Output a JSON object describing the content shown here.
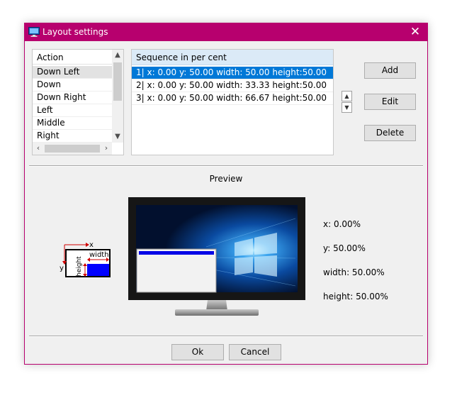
{
  "window": {
    "title": "Layout settings"
  },
  "action_list": {
    "header": "Action",
    "items": [
      "Down Left",
      "Down",
      "Down Right",
      "Left",
      "Middle",
      "Right"
    ],
    "selected": 0
  },
  "sequence_list": {
    "header": "Sequence in per cent",
    "rows": [
      "1|  x:  0.00   y: 50.00   width:  50.00   height:50.00",
      "2|  x:  0.00   y: 50.00   width:  33.33   height:50.00",
      "3|  x:  0.00   y: 50.00   width:  66.67   height:50.00"
    ],
    "selected": 0
  },
  "buttons": {
    "add": "Add",
    "edit": "Edit",
    "delete": "Delete",
    "ok": "Ok",
    "cancel": "Cancel"
  },
  "spinner": {
    "up": "▲",
    "down": "▼"
  },
  "preview": {
    "label": "Preview",
    "diagram": {
      "x": "x",
      "y": "y",
      "width": "width",
      "height": "height"
    },
    "info": {
      "x": "x: 0.00%",
      "y": "y: 50.00%",
      "width": "width: 50.00%",
      "height": "height: 50.00%"
    }
  },
  "colors": {
    "title_bar": "#b7006e",
    "selection": "#0078d7",
    "diagram_fill": "#0000ff",
    "diagram_arrow": "#d00000"
  }
}
